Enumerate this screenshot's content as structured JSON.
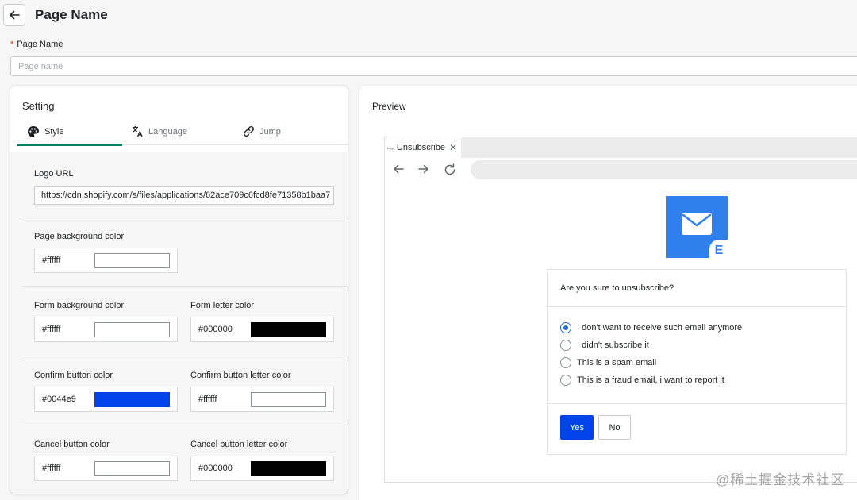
{
  "header": {
    "title": "Page Name"
  },
  "page_name_field": {
    "label": "Page Name",
    "required_mark": "*",
    "placeholder": "Page name",
    "value": ""
  },
  "setting": {
    "title": "Setting",
    "tabs": [
      {
        "label": "Style",
        "icon": "palette-icon",
        "active": true
      },
      {
        "label": "Language",
        "icon": "translate-icon",
        "active": false
      },
      {
        "label": "Jump",
        "icon": "link-icon",
        "active": false
      }
    ],
    "logo_url": {
      "label": "Logo URL",
      "value": "https://cdn.shopify.com/s/files/applications/62ace709c6fcd8fe71358b1baa7"
    },
    "colors": {
      "page_bg": {
        "label": "Page background color",
        "value": "#ffffff"
      },
      "form_bg": {
        "label": "Form background color",
        "value": "#ffffff"
      },
      "form_letter": {
        "label": "Form letter color",
        "value": "#000000"
      },
      "confirm_btn": {
        "label": "Confirm button color",
        "value": "#0044e9"
      },
      "confirm_btn_letter": {
        "label": "Confirm button letter color",
        "value": "#ffffff"
      },
      "cancel_btn": {
        "label": "Cancel button color",
        "value": "#ffffff"
      },
      "cancel_btn_letter": {
        "label": "Cancel button letter color",
        "value": "#000000"
      }
    }
  },
  "preview": {
    "title": "Preview",
    "browser_tab": {
      "title": "Unsubscribe",
      "favicon_text": "Logo"
    },
    "logo_letter": "E",
    "form": {
      "question": "Are you sure to unsubscribe?",
      "options": [
        {
          "label": "I don't want to receive such email anymore",
          "checked": true
        },
        {
          "label": "I didn't subscribe it",
          "checked": false
        },
        {
          "label": "This is a spam email",
          "checked": false
        },
        {
          "label": "This is a fraud email, i want to report it",
          "checked": false
        }
      ],
      "confirm_label": "Yes",
      "cancel_label": "No"
    }
  },
  "watermark": "@稀土掘金技术社区",
  "accent_colors": {
    "tab_underline": "#008060",
    "logo_blue": "#2f80ed",
    "radio_blue": "#2c6ecb"
  }
}
